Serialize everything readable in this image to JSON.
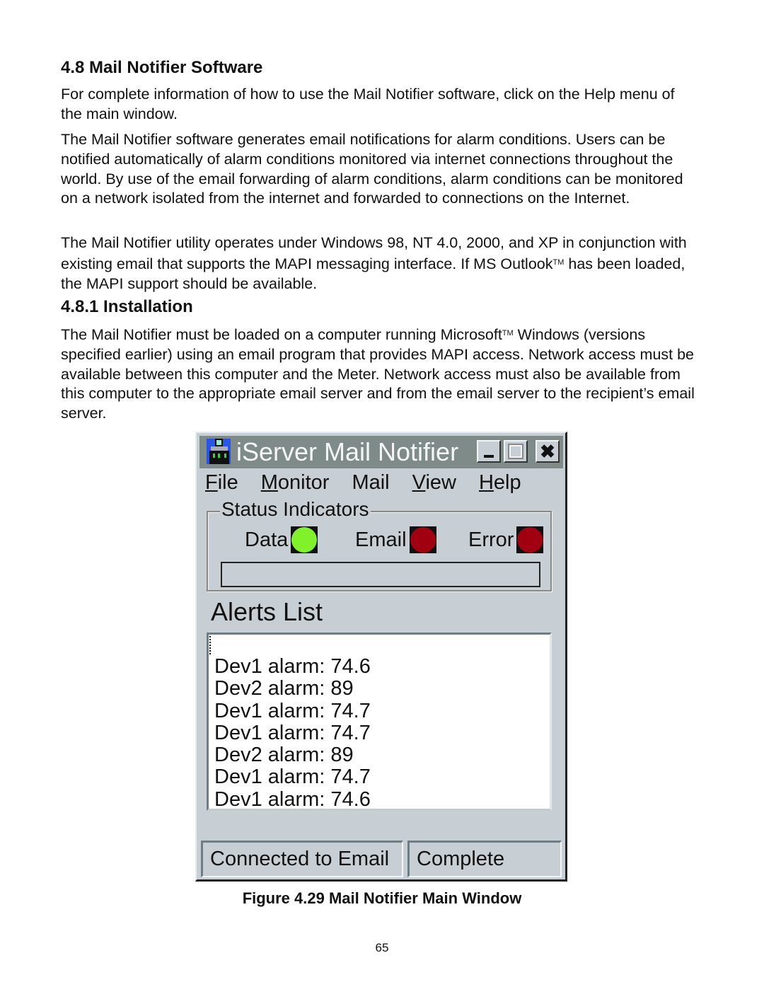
{
  "doc": {
    "heading": "4.8  Mail Notifier Software",
    "paragraph1": "For complete information of how to use the Mail Notifier software, click on the Help menu of the main window.",
    "paragraph2": "The Mail Notifier software generates email notifications for alarm conditions. Users can be notified automatically of alarm conditions monitored via internet connections throughout the world. By use of the email forwarding of alarm conditions, alarm conditions can be monitored on a network isolated from the internet and forwarded to connections on the Internet.",
    "paragraph3_a": "The Mail Notifier utility operates under Windows 98, NT 4.0, 2000, and XP in conjunction with existing email that supports the MAPI messaging interface. If MS Outlook",
    "paragraph3_tm": "TM",
    "paragraph3_b": " has been loaded, the MAPI support should be available.",
    "subheading": "4.8.1  Installation",
    "paragraph4_a": "The Mail Notifier must be loaded on a computer running Microsoft",
    "paragraph4_tm": "TM",
    "paragraph4_b": " Windows (versions specified earlier) using an email program that provides MAPI access. Network access must be available between this computer and the Meter. Network access must also be available from this computer to the appropriate email server and from the email server to the recipient’s email server.",
    "figure_caption": "Figure 4.29  Mail Notifier Main Window",
    "page_number": "65"
  },
  "window": {
    "title": "iServer Mail Notifier",
    "icon": "server-app-icon",
    "controls": [
      "minimize",
      "maximize",
      "close"
    ],
    "menu": [
      {
        "accel": "F",
        "rest": "ile"
      },
      {
        "accel": "M",
        "rest": "onitor"
      },
      {
        "accel": "",
        "rest": "Mail"
      },
      {
        "accel": "V",
        "rest": "iew"
      },
      {
        "accel": "H",
        "rest": "elp"
      }
    ],
    "status_group": {
      "legend": "Status Indicators",
      "indicators": [
        {
          "label": "Data",
          "state": "on",
          "color": "#80f22a"
        },
        {
          "label": "Email",
          "state": "off",
          "color": "#a0000f"
        },
        {
          "label": "Error",
          "state": "off",
          "color": "#a0000f"
        }
      ],
      "status_text": ""
    },
    "alerts": {
      "title": "Alerts List",
      "items": [
        "Dev1 alarm: 74.6",
        "Dev2 alarm: 89",
        "Dev1 alarm: 74.7",
        "Dev1 alarm: 74.7",
        "Dev2 alarm: 89",
        "Dev1 alarm: 74.7",
        "Dev1 alarm: 74.6"
      ]
    },
    "statusbar": {
      "left": "Connected to Email",
      "right": "Complete"
    },
    "colors": {
      "titlebar": "#7e8b89",
      "face": "#c8cfd4"
    }
  }
}
